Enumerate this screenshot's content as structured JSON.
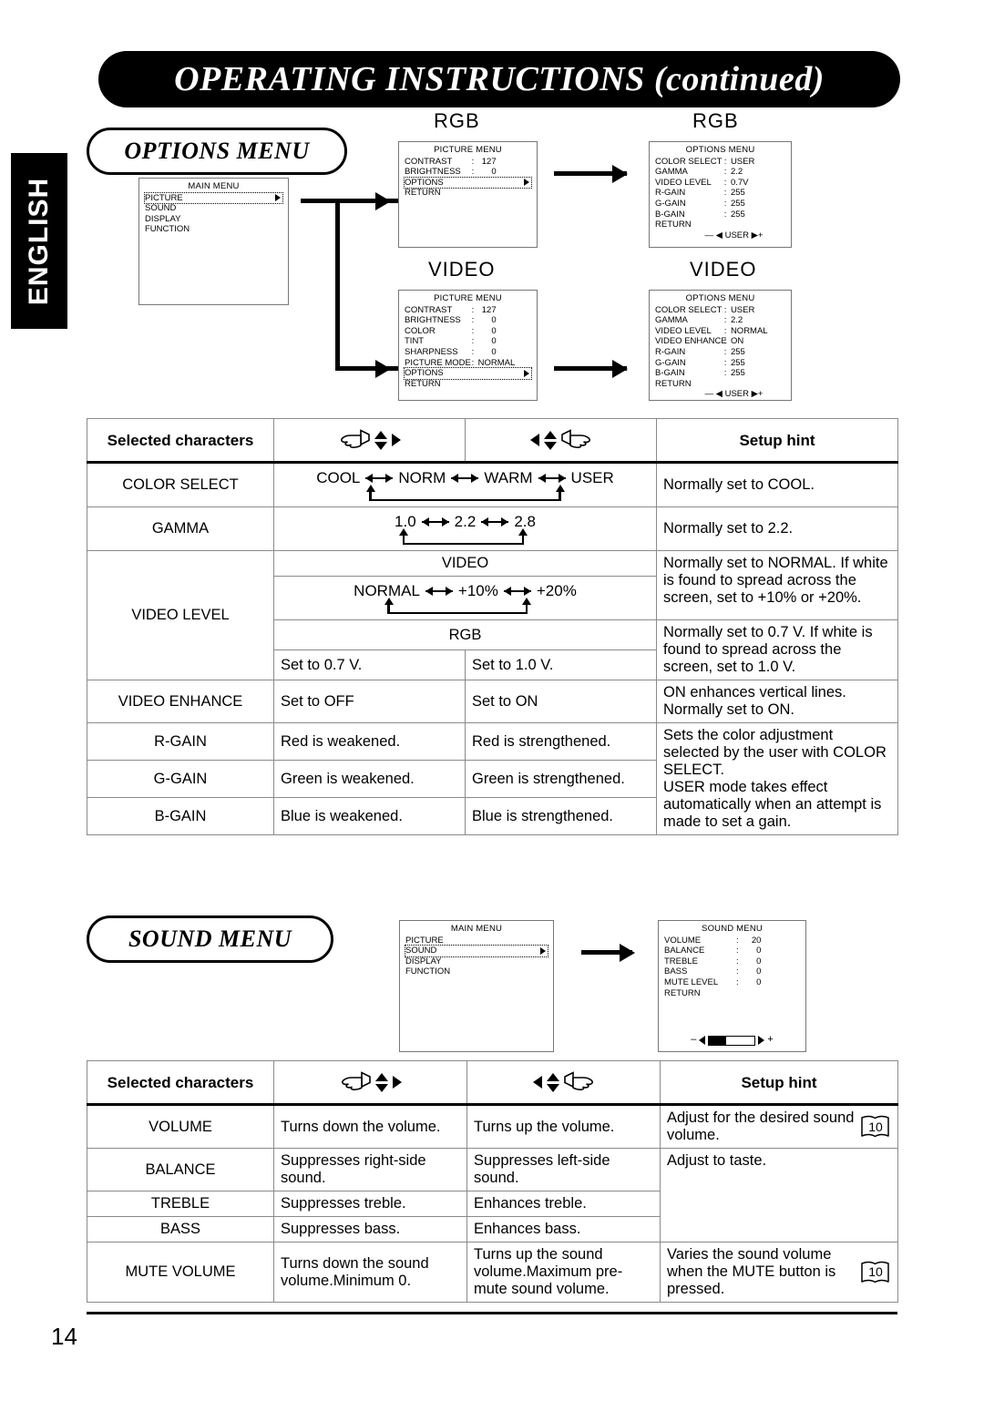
{
  "header": {
    "title": "OPERATING INSTRUCTIONS (continued)"
  },
  "sidebar": {
    "language": "ENGLISH"
  },
  "page": {
    "number": "14"
  },
  "sections": {
    "options": {
      "title": "OPTIONS MENU"
    },
    "sound": {
      "title": "SOUND MENU"
    }
  },
  "diagram_labels": {
    "rgb_top": "RGB",
    "rgb_right": "RGB",
    "video_left": "VIDEO",
    "video_right": "VIDEO"
  },
  "osd": {
    "main_menu": {
      "title": "MAIN MENU",
      "items": [
        "PICTURE",
        "SOUND",
        "DISPLAY",
        "FUNCTION"
      ],
      "highlighted": "PICTURE"
    },
    "main_menu_sound": {
      "title": "MAIN MENU",
      "items": [
        "PICTURE",
        "SOUND",
        "DISPLAY",
        "FUNCTION"
      ],
      "highlighted": "SOUND"
    },
    "picture_menu_rgb": {
      "title": "PICTURE MENU",
      "rows": [
        {
          "key": "CONTRAST",
          "colon": ":",
          "value": "127"
        },
        {
          "key": "BRIGHTNESS",
          "colon": ":",
          "value": "0"
        }
      ],
      "highlighted": "OPTIONS",
      "tail": "RETURN"
    },
    "picture_menu_video": {
      "title": "PICTURE MENU",
      "rows": [
        {
          "key": "CONTRAST",
          "colon": ":",
          "value": "127"
        },
        {
          "key": "BRIGHTNESS",
          "colon": ":",
          "value": "0"
        },
        {
          "key": "COLOR",
          "colon": ":",
          "value": "0"
        },
        {
          "key": "TINT",
          "colon": ":",
          "value": "0"
        },
        {
          "key": "SHARPNESS",
          "colon": ":",
          "value": "0"
        },
        {
          "key": "PICTURE MODE",
          "colon": ":",
          "value": "NORMAL"
        }
      ],
      "highlighted": "OPTIONS",
      "tail": "RETURN"
    },
    "options_menu_rgb": {
      "title": "OPTIONS MENU",
      "rows": [
        {
          "key": "COLOR SELECT",
          "colon": ":",
          "value": "USER"
        },
        {
          "key": "GAMMA",
          "colon": ":",
          "value": "2.2"
        },
        {
          "key": "VIDEO LEVEL",
          "colon": ":",
          "value": "0.7V"
        },
        {
          "key": "R-GAIN",
          "colon": ":",
          "value": "255"
        },
        {
          "key": "G-GAIN",
          "colon": ":",
          "value": "255"
        },
        {
          "key": "B-GAIN",
          "colon": ":",
          "value": "255"
        }
      ],
      "tail": "RETURN",
      "footbar": "— ◀ USER   ▶+"
    },
    "options_menu_video": {
      "title": "OPTIONS MENU",
      "rows": [
        {
          "key": "COLOR SELECT",
          "colon": ":",
          "value": "USER"
        },
        {
          "key": "GAMMA",
          "colon": ":",
          "value": "2.2"
        },
        {
          "key": "VIDEO LEVEL",
          "colon": ":",
          "value": "NORMAL"
        },
        {
          "key": "VIDEO ENHANCE",
          "colon": ":",
          "value": "ON"
        },
        {
          "key": "R-GAIN",
          "colon": ":",
          "value": "255"
        },
        {
          "key": "G-GAIN",
          "colon": ":",
          "value": "255"
        },
        {
          "key": "B-GAIN",
          "colon": ":",
          "value": "255"
        }
      ],
      "tail": "RETURN",
      "footbar": "— ◀ USER   ▶+"
    },
    "sound_menu": {
      "title": "SOUND MENU",
      "rows": [
        {
          "key": "VOLUME",
          "colon": ":",
          "value": "20"
        },
        {
          "key": "BALANCE",
          "colon": ":",
          "value": "0"
        },
        {
          "key": "TREBLE",
          "colon": ":",
          "value": "0"
        },
        {
          "key": "BASS",
          "colon": ":",
          "value": "0"
        },
        {
          "key": "MUTE LEVEL",
          "colon": ":",
          "value": "0"
        }
      ],
      "tail": "RETURN",
      "minus": "–",
      "plus": "+"
    }
  },
  "options_table": {
    "headers": {
      "selected": "Selected characters",
      "left_icon": "hand-left-dpad-icon",
      "right_icon": "hand-right-dpad-icon",
      "hint": "Setup hint"
    },
    "rows": [
      {
        "name": "COLOR SELECT",
        "type": "sequence",
        "sequence": [
          "COOL",
          "NORM",
          "WARM",
          "USER"
        ],
        "hint": "Normally set to COOL."
      },
      {
        "name": "GAMMA",
        "type": "sequence",
        "sequence": [
          "1.0",
          "2.2",
          "2.8"
        ],
        "hint": "Normally set to 2.2."
      },
      {
        "name": "VIDEO LEVEL",
        "type": "split",
        "video_label": "VIDEO",
        "video_sequence": [
          "NORMAL",
          "+10%",
          "+20%"
        ],
        "video_hint": "Normally set to NORMAL. If white is found to spread across the screen, set to +10% or +20%.",
        "rgb_label": "RGB",
        "rgb_left": "Set to 0.7 V.",
        "rgb_right": "Set to 1.0 V.",
        "rgb_hint": "Normally set to 0.7 V. If white is found to spread across the screen, set to 1.0 V."
      },
      {
        "name": "VIDEO ENHANCE",
        "type": "pair",
        "left": "Set to OFF",
        "right": "Set to ON",
        "hint": "ON enhances vertical lines. Normally set to ON."
      },
      {
        "name": "R-GAIN",
        "type": "pair",
        "left": "Red is weakened.",
        "right": "Red is strengthened.",
        "hint": "Sets the color adjustment selected by the user with COLOR SELECT.\nUSER mode takes effect automatically when an attempt is made to set a gain."
      },
      {
        "name": "G-GAIN",
        "type": "pair",
        "left": "Green is weakened.",
        "right": "Green is strengthened."
      },
      {
        "name": "B-GAIN",
        "type": "pair",
        "left": "Blue is weakened.",
        "right": "Blue is strengthened."
      }
    ],
    "gain_hint_lines": [
      "Sets the color adjustment",
      "selected by the user with COLOR",
      "SELECT.",
      "USER mode takes effect",
      "automatically when an attempt is",
      "made to set a gain."
    ]
  },
  "sound_table": {
    "headers": {
      "selected": "Selected characters",
      "left_icon": "hand-left-dpad-icon",
      "right_icon": "hand-right-dpad-icon",
      "hint": "Setup hint"
    },
    "rows": [
      {
        "name": "VOLUME",
        "left": "Turns down the volume.",
        "right": "Turns up the volume.",
        "hint": "Adjust for the desired sound volume.",
        "page_ref": "10"
      },
      {
        "name": "BALANCE",
        "left": "Suppresses right-side sound.",
        "right": "Suppresses left-side sound.",
        "hint": "Adjust to taste."
      },
      {
        "name": "TREBLE",
        "left": "Suppresses treble.",
        "right": "Enhances treble."
      },
      {
        "name": "BASS",
        "left": "Suppresses bass.",
        "right": "Enhances bass."
      },
      {
        "name": "MUTE VOLUME",
        "left": "Turns down the sound volume.Minimum 0.",
        "right": "Turns up the sound volume.Maximum pre-mute sound volume.",
        "hint": "Varies the sound volume when the MUTE button is pressed.",
        "page_ref": "10"
      }
    ]
  }
}
